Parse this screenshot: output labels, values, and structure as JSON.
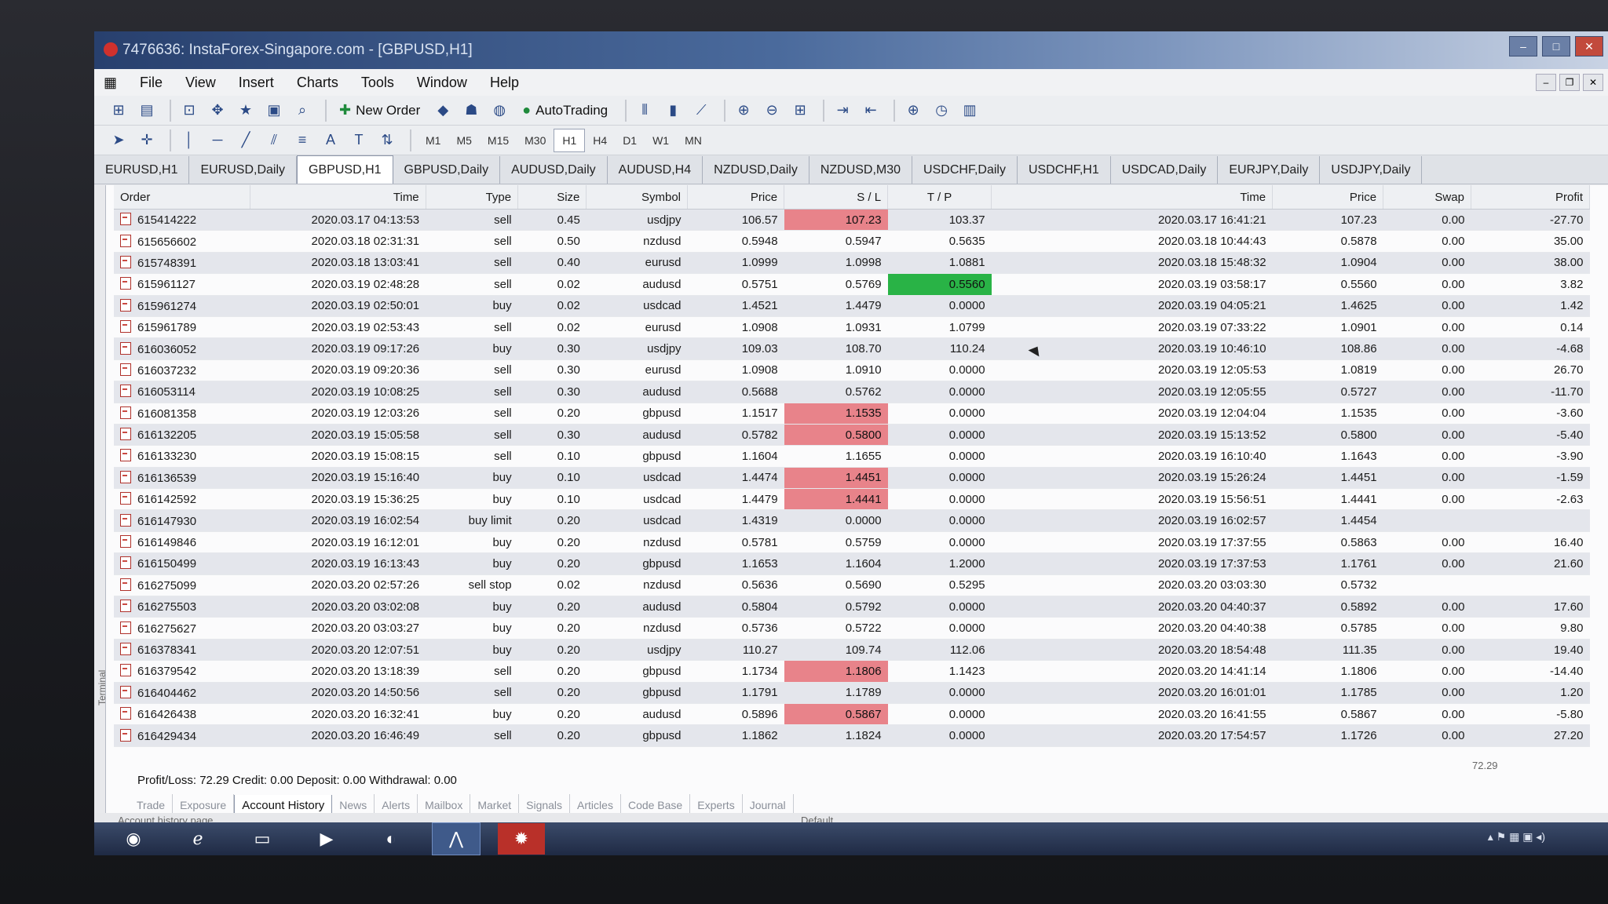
{
  "window": {
    "title": "7476636: InstaForex-Singapore.com - [GBPUSD,H1]"
  },
  "menu": [
    "File",
    "View",
    "Insert",
    "Charts",
    "Tools",
    "Window",
    "Help"
  ],
  "toolbar": {
    "new_order": "New Order",
    "autotrading": "AutoTrading"
  },
  "timeframes": [
    "M1",
    "M5",
    "M15",
    "M30",
    "H1",
    "H4",
    "D1",
    "W1",
    "MN"
  ],
  "chart_tabs": [
    "EURUSD,H1",
    "EURUSD,Daily",
    "GBPUSD,H1",
    "GBPUSD,Daily",
    "AUDUSD,Daily",
    "AUDUSD,H4",
    "NZDUSD,Daily",
    "NZDUSD,M30",
    "USDCHF,Daily",
    "USDCHF,H1",
    "USDCAD,Daily",
    "EURJPY,Daily",
    "USDJPY,Daily"
  ],
  "columns": [
    "Order",
    "Time",
    "Type",
    "Size",
    "Symbol",
    "Price",
    "S / L",
    "T / P",
    "Time",
    "Price",
    "Swap",
    "Profit"
  ],
  "rows": [
    {
      "order": "615414222",
      "open": "2020.03.17 04:13:53",
      "type": "sell",
      "size": "0.45",
      "symbol": "usdjpy",
      "price": "106.57",
      "sl": "107.23",
      "tp": "103.37",
      "close": "2020.03.17 16:41:21",
      "cprice": "107.23",
      "swap": "0.00",
      "profit": "-27.70",
      "sl_hit": true
    },
    {
      "order": "615656602",
      "open": "2020.03.18 02:31:31",
      "type": "sell",
      "size": "0.50",
      "symbol": "nzdusd",
      "price": "0.5948",
      "sl": "0.5947",
      "tp": "0.5635",
      "close": "2020.03.18 10:44:43",
      "cprice": "0.5878",
      "swap": "0.00",
      "profit": "35.00"
    },
    {
      "order": "615748391",
      "open": "2020.03.18 13:03:41",
      "type": "sell",
      "size": "0.40",
      "symbol": "eurusd",
      "price": "1.0999",
      "sl": "1.0998",
      "tp": "1.0881",
      "close": "2020.03.18 15:48:32",
      "cprice": "1.0904",
      "swap": "0.00",
      "profit": "38.00"
    },
    {
      "order": "615961127",
      "open": "2020.03.19 02:48:28",
      "type": "sell",
      "size": "0.02",
      "symbol": "audusd",
      "price": "0.5751",
      "sl": "0.5769",
      "tp": "0.5560",
      "close": "2020.03.19 03:58:17",
      "cprice": "0.5560",
      "swap": "0.00",
      "profit": "3.82",
      "tp_hit": true
    },
    {
      "order": "615961274",
      "open": "2020.03.19 02:50:01",
      "type": "buy",
      "size": "0.02",
      "symbol": "usdcad",
      "price": "1.4521",
      "sl": "1.4479",
      "tp": "0.0000",
      "close": "2020.03.19 04:05:21",
      "cprice": "1.4625",
      "swap": "0.00",
      "profit": "1.42"
    },
    {
      "order": "615961789",
      "open": "2020.03.19 02:53:43",
      "type": "sell",
      "size": "0.02",
      "symbol": "eurusd",
      "price": "1.0908",
      "sl": "1.0931",
      "tp": "1.0799",
      "close": "2020.03.19 07:33:22",
      "cprice": "1.0901",
      "swap": "0.00",
      "profit": "0.14"
    },
    {
      "order": "616036052",
      "open": "2020.03.19 09:17:26",
      "type": "buy",
      "size": "0.30",
      "symbol": "usdjpy",
      "price": "109.03",
      "sl": "108.70",
      "tp": "110.24",
      "close": "2020.03.19 10:46:10",
      "cprice": "108.86",
      "swap": "0.00",
      "profit": "-4.68"
    },
    {
      "order": "616037232",
      "open": "2020.03.19 09:20:36",
      "type": "sell",
      "size": "0.30",
      "symbol": "eurusd",
      "price": "1.0908",
      "sl": "1.0910",
      "tp": "0.0000",
      "close": "2020.03.19 12:05:53",
      "cprice": "1.0819",
      "swap": "0.00",
      "profit": "26.70"
    },
    {
      "order": "616053114",
      "open": "2020.03.19 10:08:25",
      "type": "sell",
      "size": "0.30",
      "symbol": "audusd",
      "price": "0.5688",
      "sl": "0.5762",
      "tp": "0.0000",
      "close": "2020.03.19 12:05:55",
      "cprice": "0.5727",
      "swap": "0.00",
      "profit": "-11.70"
    },
    {
      "order": "616081358",
      "open": "2020.03.19 12:03:26",
      "type": "sell",
      "size": "0.20",
      "symbol": "gbpusd",
      "price": "1.1517",
      "sl": "1.1535",
      "tp": "0.0000",
      "close": "2020.03.19 12:04:04",
      "cprice": "1.1535",
      "swap": "0.00",
      "profit": "-3.60",
      "sl_hit": true
    },
    {
      "order": "616132205",
      "open": "2020.03.19 15:05:58",
      "type": "sell",
      "size": "0.30",
      "symbol": "audusd",
      "price": "0.5782",
      "sl": "0.5800",
      "tp": "0.0000",
      "close": "2020.03.19 15:13:52",
      "cprice": "0.5800",
      "swap": "0.00",
      "profit": "-5.40",
      "sl_hit": true
    },
    {
      "order": "616133230",
      "open": "2020.03.19 15:08:15",
      "type": "sell",
      "size": "0.10",
      "symbol": "gbpusd",
      "price": "1.1604",
      "sl": "1.1655",
      "tp": "0.0000",
      "close": "2020.03.19 16:10:40",
      "cprice": "1.1643",
      "swap": "0.00",
      "profit": "-3.90"
    },
    {
      "order": "616136539",
      "open": "2020.03.19 15:16:40",
      "type": "buy",
      "size": "0.10",
      "symbol": "usdcad",
      "price": "1.4474",
      "sl": "1.4451",
      "tp": "0.0000",
      "close": "2020.03.19 15:26:24",
      "cprice": "1.4451",
      "swap": "0.00",
      "profit": "-1.59",
      "sl_hit": true
    },
    {
      "order": "616142592",
      "open": "2020.03.19 15:36:25",
      "type": "buy",
      "size": "0.10",
      "symbol": "usdcad",
      "price": "1.4479",
      "sl": "1.4441",
      "tp": "0.0000",
      "close": "2020.03.19 15:56:51",
      "cprice": "1.4441",
      "swap": "0.00",
      "profit": "-2.63",
      "sl_hit": true
    },
    {
      "order": "616147930",
      "open": "2020.03.19 16:02:54",
      "type": "buy limit",
      "size": "0.20",
      "symbol": "usdcad",
      "price": "1.4319",
      "sl": "0.0000",
      "tp": "0.0000",
      "close": "2020.03.19 16:02:57",
      "cprice": "1.4454",
      "swap": "",
      "profit": ""
    },
    {
      "order": "616149846",
      "open": "2020.03.19 16:12:01",
      "type": "buy",
      "size": "0.20",
      "symbol": "nzdusd",
      "price": "0.5781",
      "sl": "0.5759",
      "tp": "0.0000",
      "close": "2020.03.19 17:37:55",
      "cprice": "0.5863",
      "swap": "0.00",
      "profit": "16.40"
    },
    {
      "order": "616150499",
      "open": "2020.03.19 16:13:43",
      "type": "buy",
      "size": "0.20",
      "symbol": "gbpusd",
      "price": "1.1653",
      "sl": "1.1604",
      "tp": "1.2000",
      "close": "2020.03.19 17:37:53",
      "cprice": "1.1761",
      "swap": "0.00",
      "profit": "21.60"
    },
    {
      "order": "616275099",
      "open": "2020.03.20 02:57:26",
      "type": "sell stop",
      "size": "0.02",
      "symbol": "nzdusd",
      "price": "0.5636",
      "sl": "0.5690",
      "tp": "0.5295",
      "close": "2020.03.20 03:03:30",
      "cprice": "0.5732",
      "swap": "",
      "profit": ""
    },
    {
      "order": "616275503",
      "open": "2020.03.20 03:02:08",
      "type": "buy",
      "size": "0.20",
      "symbol": "audusd",
      "price": "0.5804",
      "sl": "0.5792",
      "tp": "0.0000",
      "close": "2020.03.20 04:40:37",
      "cprice": "0.5892",
      "swap": "0.00",
      "profit": "17.60"
    },
    {
      "order": "616275627",
      "open": "2020.03.20 03:03:27",
      "type": "buy",
      "size": "0.20",
      "symbol": "nzdusd",
      "price": "0.5736",
      "sl": "0.5722",
      "tp": "0.0000",
      "close": "2020.03.20 04:40:38",
      "cprice": "0.5785",
      "swap": "0.00",
      "profit": "9.80"
    },
    {
      "order": "616378341",
      "open": "2020.03.20 12:07:51",
      "type": "buy",
      "size": "0.20",
      "symbol": "usdjpy",
      "price": "110.27",
      "sl": "109.74",
      "tp": "112.06",
      "close": "2020.03.20 18:54:48",
      "cprice": "111.35",
      "swap": "0.00",
      "profit": "19.40"
    },
    {
      "order": "616379542",
      "open": "2020.03.20 13:18:39",
      "type": "sell",
      "size": "0.20",
      "symbol": "gbpusd",
      "price": "1.1734",
      "sl": "1.1806",
      "tp": "1.1423",
      "close": "2020.03.20 14:41:14",
      "cprice": "1.1806",
      "swap": "0.00",
      "profit": "-14.40",
      "sl_hit": true
    },
    {
      "order": "616404462",
      "open": "2020.03.20 14:50:56",
      "type": "sell",
      "size": "0.20",
      "symbol": "gbpusd",
      "price": "1.1791",
      "sl": "1.1789",
      "tp": "0.0000",
      "close": "2020.03.20 16:01:01",
      "cprice": "1.1785",
      "swap": "0.00",
      "profit": "1.20"
    },
    {
      "order": "616426438",
      "open": "2020.03.20 16:32:41",
      "type": "buy",
      "size": "0.20",
      "symbol": "audusd",
      "price": "0.5896",
      "sl": "0.5867",
      "tp": "0.0000",
      "close": "2020.03.20 16:41:55",
      "cprice": "0.5867",
      "swap": "0.00",
      "profit": "-5.80",
      "sl_hit": true
    },
    {
      "order": "616429434",
      "open": "2020.03.20 16:46:49",
      "type": "sell",
      "size": "0.20",
      "symbol": "gbpusd",
      "price": "1.1862",
      "sl": "1.1824",
      "tp": "0.0000",
      "close": "2020.03.20 17:54:57",
      "cprice": "1.1726",
      "swap": "0.00",
      "profit": "27.20"
    }
  ],
  "summary": {
    "text": "Profit/Loss: 72.29  Credit: 0.00  Deposit: 0.00  Withdrawal: 0.00",
    "total": "72.29"
  },
  "terminal_label": "Terminal",
  "bottom_tabs": [
    "Trade",
    "Exposure",
    "Account History",
    "News",
    "Alerts",
    "Mailbox",
    "Market",
    "Signals",
    "Articles",
    "Code Base",
    "Experts",
    "Journal"
  ],
  "status": {
    "hint": "Account history page",
    "profile": "Default"
  },
  "colors": {
    "sl_hit": "#e8838a",
    "tp_hit": "#29b346",
    "title_bar": "#28406e"
  }
}
